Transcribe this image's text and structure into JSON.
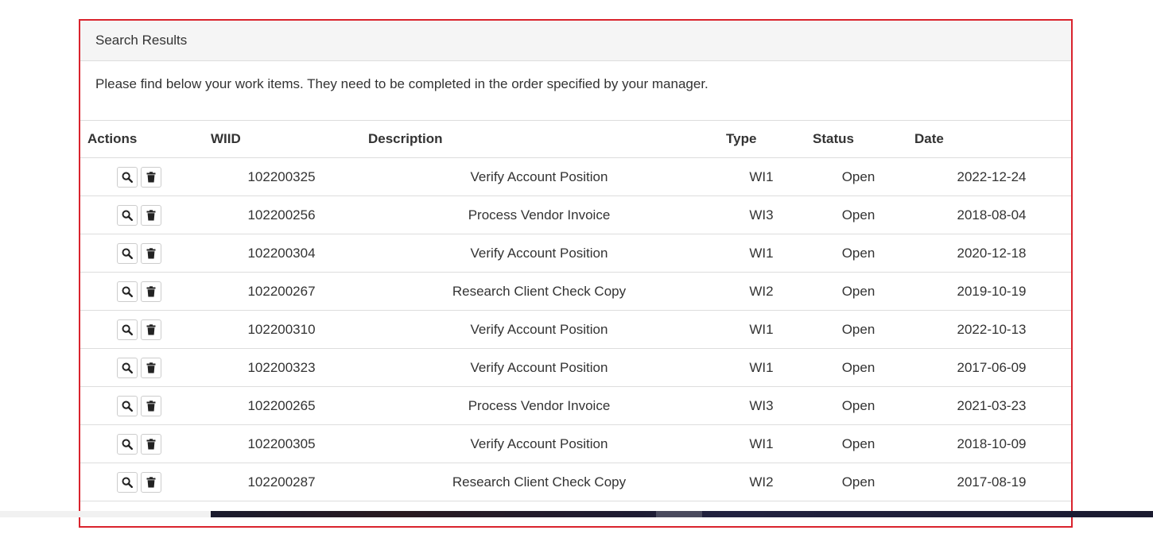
{
  "panel": {
    "heading": "Search Results",
    "intro": "Please find below your work items. They need to be completed in the order specified by your manager."
  },
  "table": {
    "headers": {
      "actions": "Actions",
      "wiid": "WIID",
      "description": "Description",
      "type": "Type",
      "status": "Status",
      "date": "Date"
    },
    "rows": [
      {
        "wiid": "102200325",
        "description": "Verify Account Position",
        "type": "WI1",
        "status": "Open",
        "date": "2022-12-24"
      },
      {
        "wiid": "102200256",
        "description": "Process Vendor Invoice",
        "type": "WI3",
        "status": "Open",
        "date": "2018-08-04"
      },
      {
        "wiid": "102200304",
        "description": "Verify Account Position",
        "type": "WI1",
        "status": "Open",
        "date": "2020-12-18"
      },
      {
        "wiid": "102200267",
        "description": "Research Client Check Copy",
        "type": "WI2",
        "status": "Open",
        "date": "2019-10-19"
      },
      {
        "wiid": "102200310",
        "description": "Verify Account Position",
        "type": "WI1",
        "status": "Open",
        "date": "2022-10-13"
      },
      {
        "wiid": "102200323",
        "description": "Verify Account Position",
        "type": "WI1",
        "status": "Open",
        "date": "2017-06-09"
      },
      {
        "wiid": "102200265",
        "description": "Process Vendor Invoice",
        "type": "WI3",
        "status": "Open",
        "date": "2021-03-23"
      },
      {
        "wiid": "102200305",
        "description": "Verify Account Position",
        "type": "WI1",
        "status": "Open",
        "date": "2018-10-09"
      },
      {
        "wiid": "102200287",
        "description": "Research Client Check Copy",
        "type": "WI2",
        "status": "Open",
        "date": "2017-08-19"
      }
    ]
  },
  "icons": {
    "view": "search-icon",
    "delete": "trash-icon"
  },
  "colors": {
    "panel_border": "#d9232d",
    "heading_bg": "#f5f5f5",
    "row_divider": "#dddddd",
    "text": "#333333"
  }
}
